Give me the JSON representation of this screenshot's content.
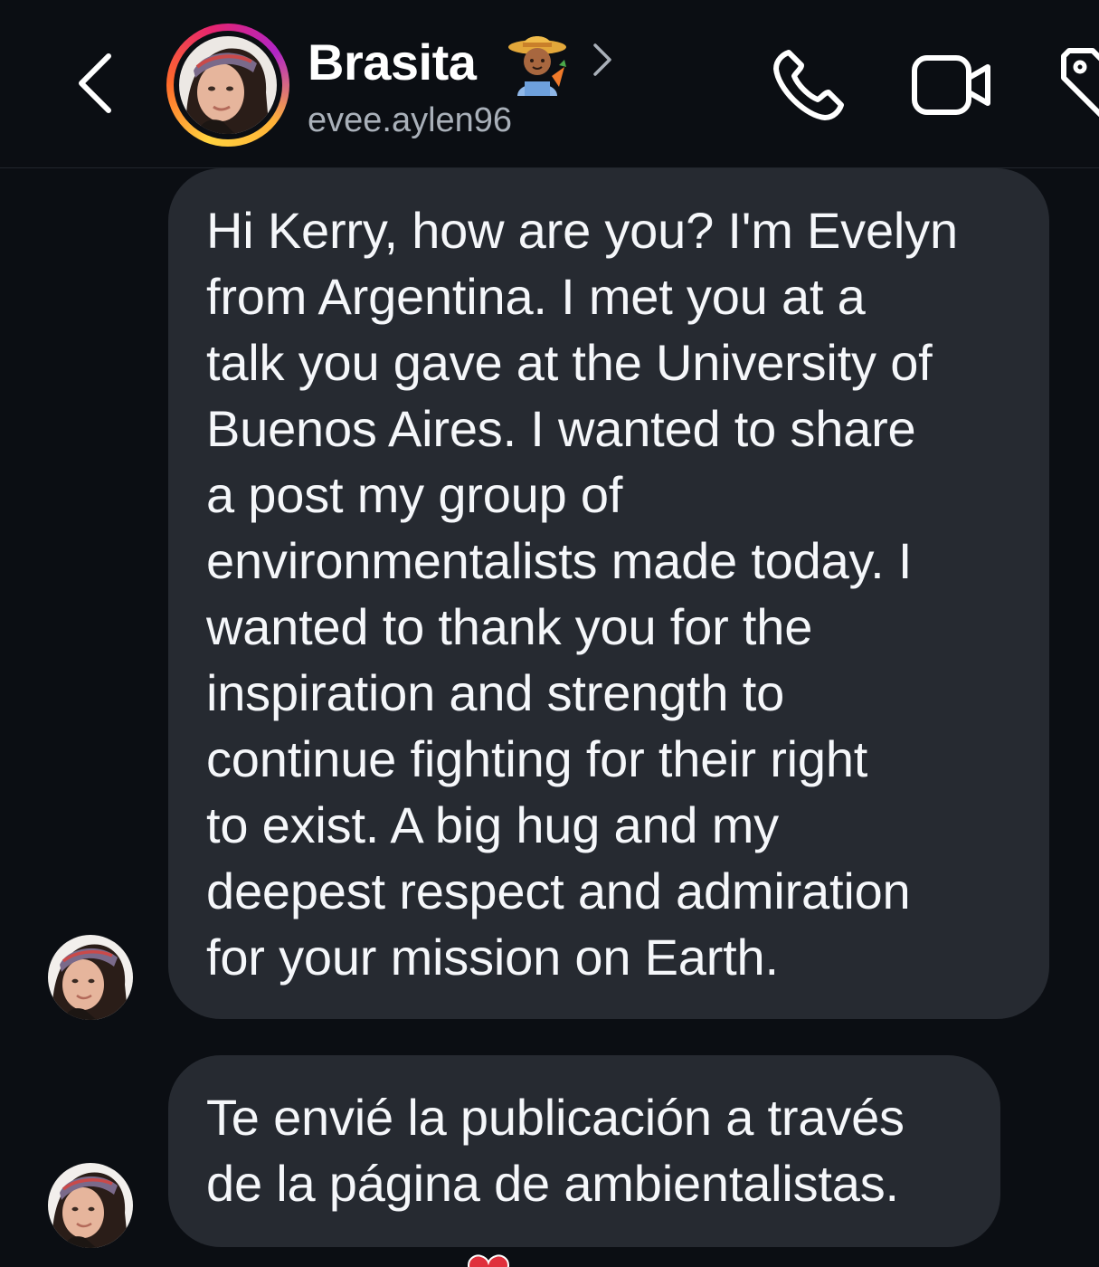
{
  "header": {
    "contact_name": "Brasita",
    "name_emoji": "farmer-emoji",
    "username": "evee.aylen96",
    "back_icon": "chevron-left-icon",
    "chevron_icon": "chevron-right-icon",
    "call_icon": "phone-icon",
    "video_icon": "video-camera-icon",
    "tag_icon": "tag-icon",
    "story_ring_colors": [
      "#ffd23f",
      "#ff6a2a",
      "#e6246f",
      "#b125c7"
    ]
  },
  "messages": [
    {
      "text": "Hi Kerry, how are you? I'm Evelyn\nfrom Argentina. I met you at a\ntalk you gave at the University of\nBuenos Aires. I wanted to share\na post my group of\nenvironmentalists made today. I\nwanted to thank you for the\ninspiration and strength to\ncontinue fighting for their right\nto exist. A big hug and my\ndeepest respect and admiration\nfor your mission on Earth."
    },
    {
      "text": "Te envié la publicación a través\nde la página de ambientalistas."
    }
  ],
  "colors": {
    "background": "#0b0e13",
    "bubble": "#262a31",
    "text": "#f5f7fa",
    "secondary_text": "#a9b0b9",
    "reaction_heart": "#e0303c"
  }
}
